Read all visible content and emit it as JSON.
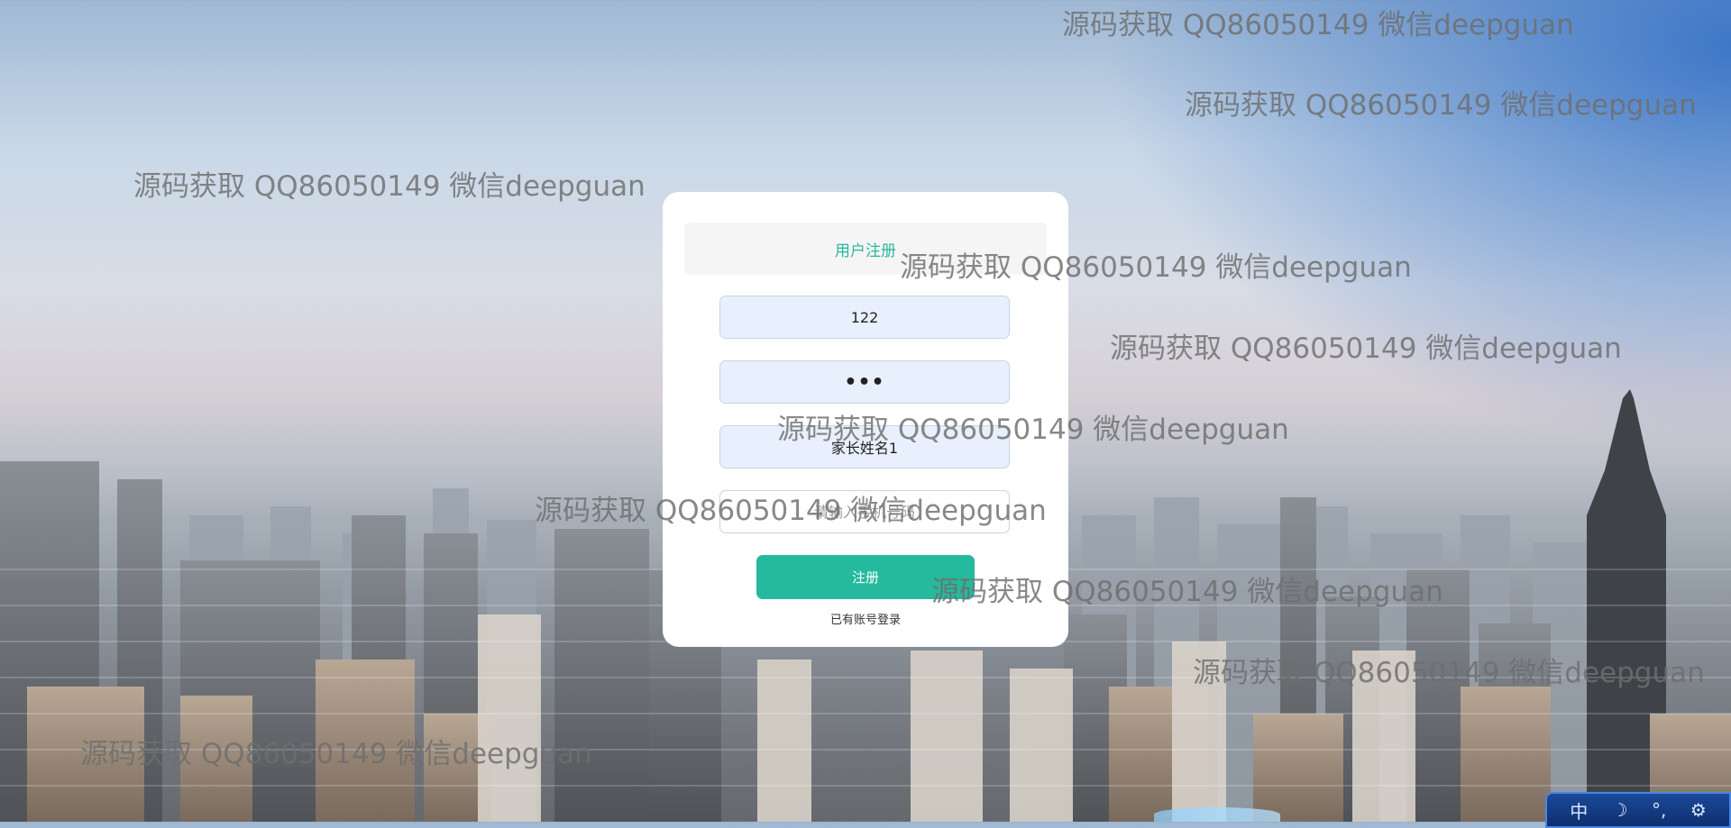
{
  "form": {
    "title": "用户注册",
    "username_value": "122",
    "password_value": "•••",
    "parent_name_value": "家长姓名1",
    "phone_placeholder": "请输入手机号码",
    "submit_label": "注册",
    "login_link_label": "已有账号登录"
  },
  "watermarks": [
    "源码获取 QQ86050149 微信deepguan",
    "源码获取 QQ86050149 微信deepguan",
    "源码获取 QQ86050149 微信deepguan",
    "源码获取 QQ86050149 微信deepguan",
    "源码获取 QQ86050149 微信deepguan",
    "源码获取 QQ86050149 微信deepguan",
    "源码获取 QQ86050149 微信deepguan",
    "源码获取 QQ86050149 微信deepguan",
    "源码获取 QQ86050149 微信deepguan",
    "源码获取 QQ86050149 微信deepguan"
  ],
  "ime_bar": {
    "lang_label": "中",
    "icons": [
      "moon-icon",
      "punctuation-icon",
      "gear-icon"
    ]
  },
  "colors": {
    "accent": "#25b99d",
    "title_color": "#27b79d",
    "field_bg": "#e8f0fd"
  }
}
